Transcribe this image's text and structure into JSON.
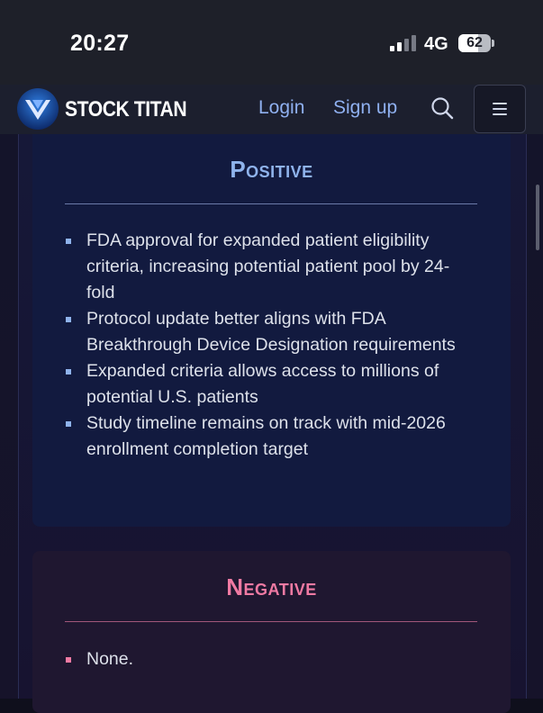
{
  "status_bar": {
    "time": "20:27",
    "network": "4G",
    "battery": "62"
  },
  "nav": {
    "brand": "STOCK TITAN",
    "login": "Login",
    "signup": "Sign up"
  },
  "positive": {
    "title": "Positive",
    "items": [
      "FDA approval for expanded patient eligibility criteria, increasing potential patient pool by 24-fold",
      "Protocol update better aligns with FDA Breakthrough Device Designation requirements",
      "Expanded criteria allows access to millions of potential U.S. patients",
      "Study timeline remains on track with mid-2026 enrollment completion target"
    ]
  },
  "negative": {
    "title": "Negative",
    "items": [
      "None."
    ]
  },
  "colors": {
    "positive_accent": "#8fb3ec",
    "negative_accent": "#f07aa3",
    "link": "#8fb0f0"
  }
}
